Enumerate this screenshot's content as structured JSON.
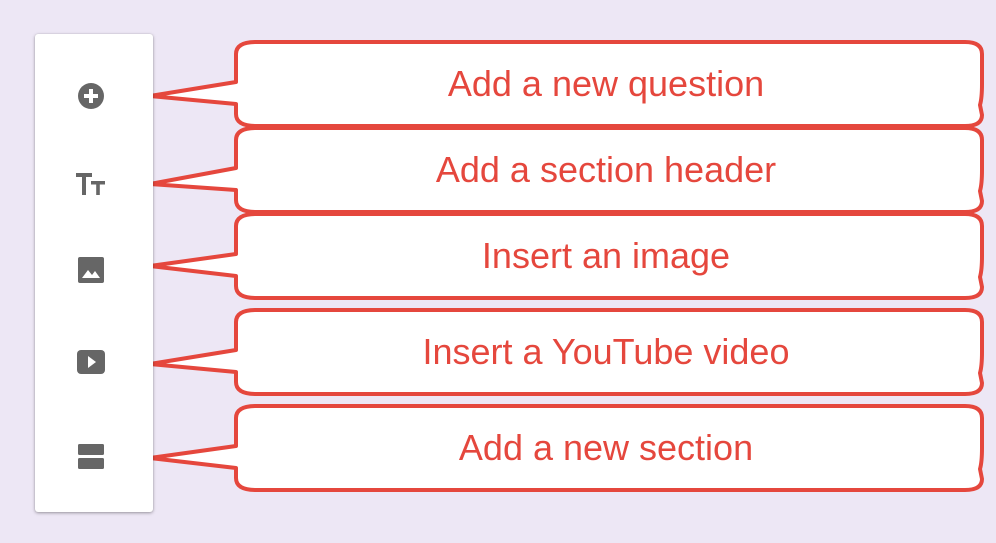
{
  "colors": {
    "background": "#ede7f5",
    "toolbar_background": "#ffffff",
    "icon": "#666666",
    "callout_stroke": "#e5473d",
    "callout_text": "#e5473d"
  },
  "toolbar": {
    "items": [
      {
        "icon": "add-circle-icon",
        "tooltip": "Add a new question"
      },
      {
        "icon": "title-text-icon",
        "tooltip": "Add a section header"
      },
      {
        "icon": "image-icon",
        "tooltip": "Insert an image"
      },
      {
        "icon": "video-play-icon",
        "tooltip": "Insert a YouTube video"
      },
      {
        "icon": "section-icon",
        "tooltip": "Add a new section"
      }
    ]
  }
}
